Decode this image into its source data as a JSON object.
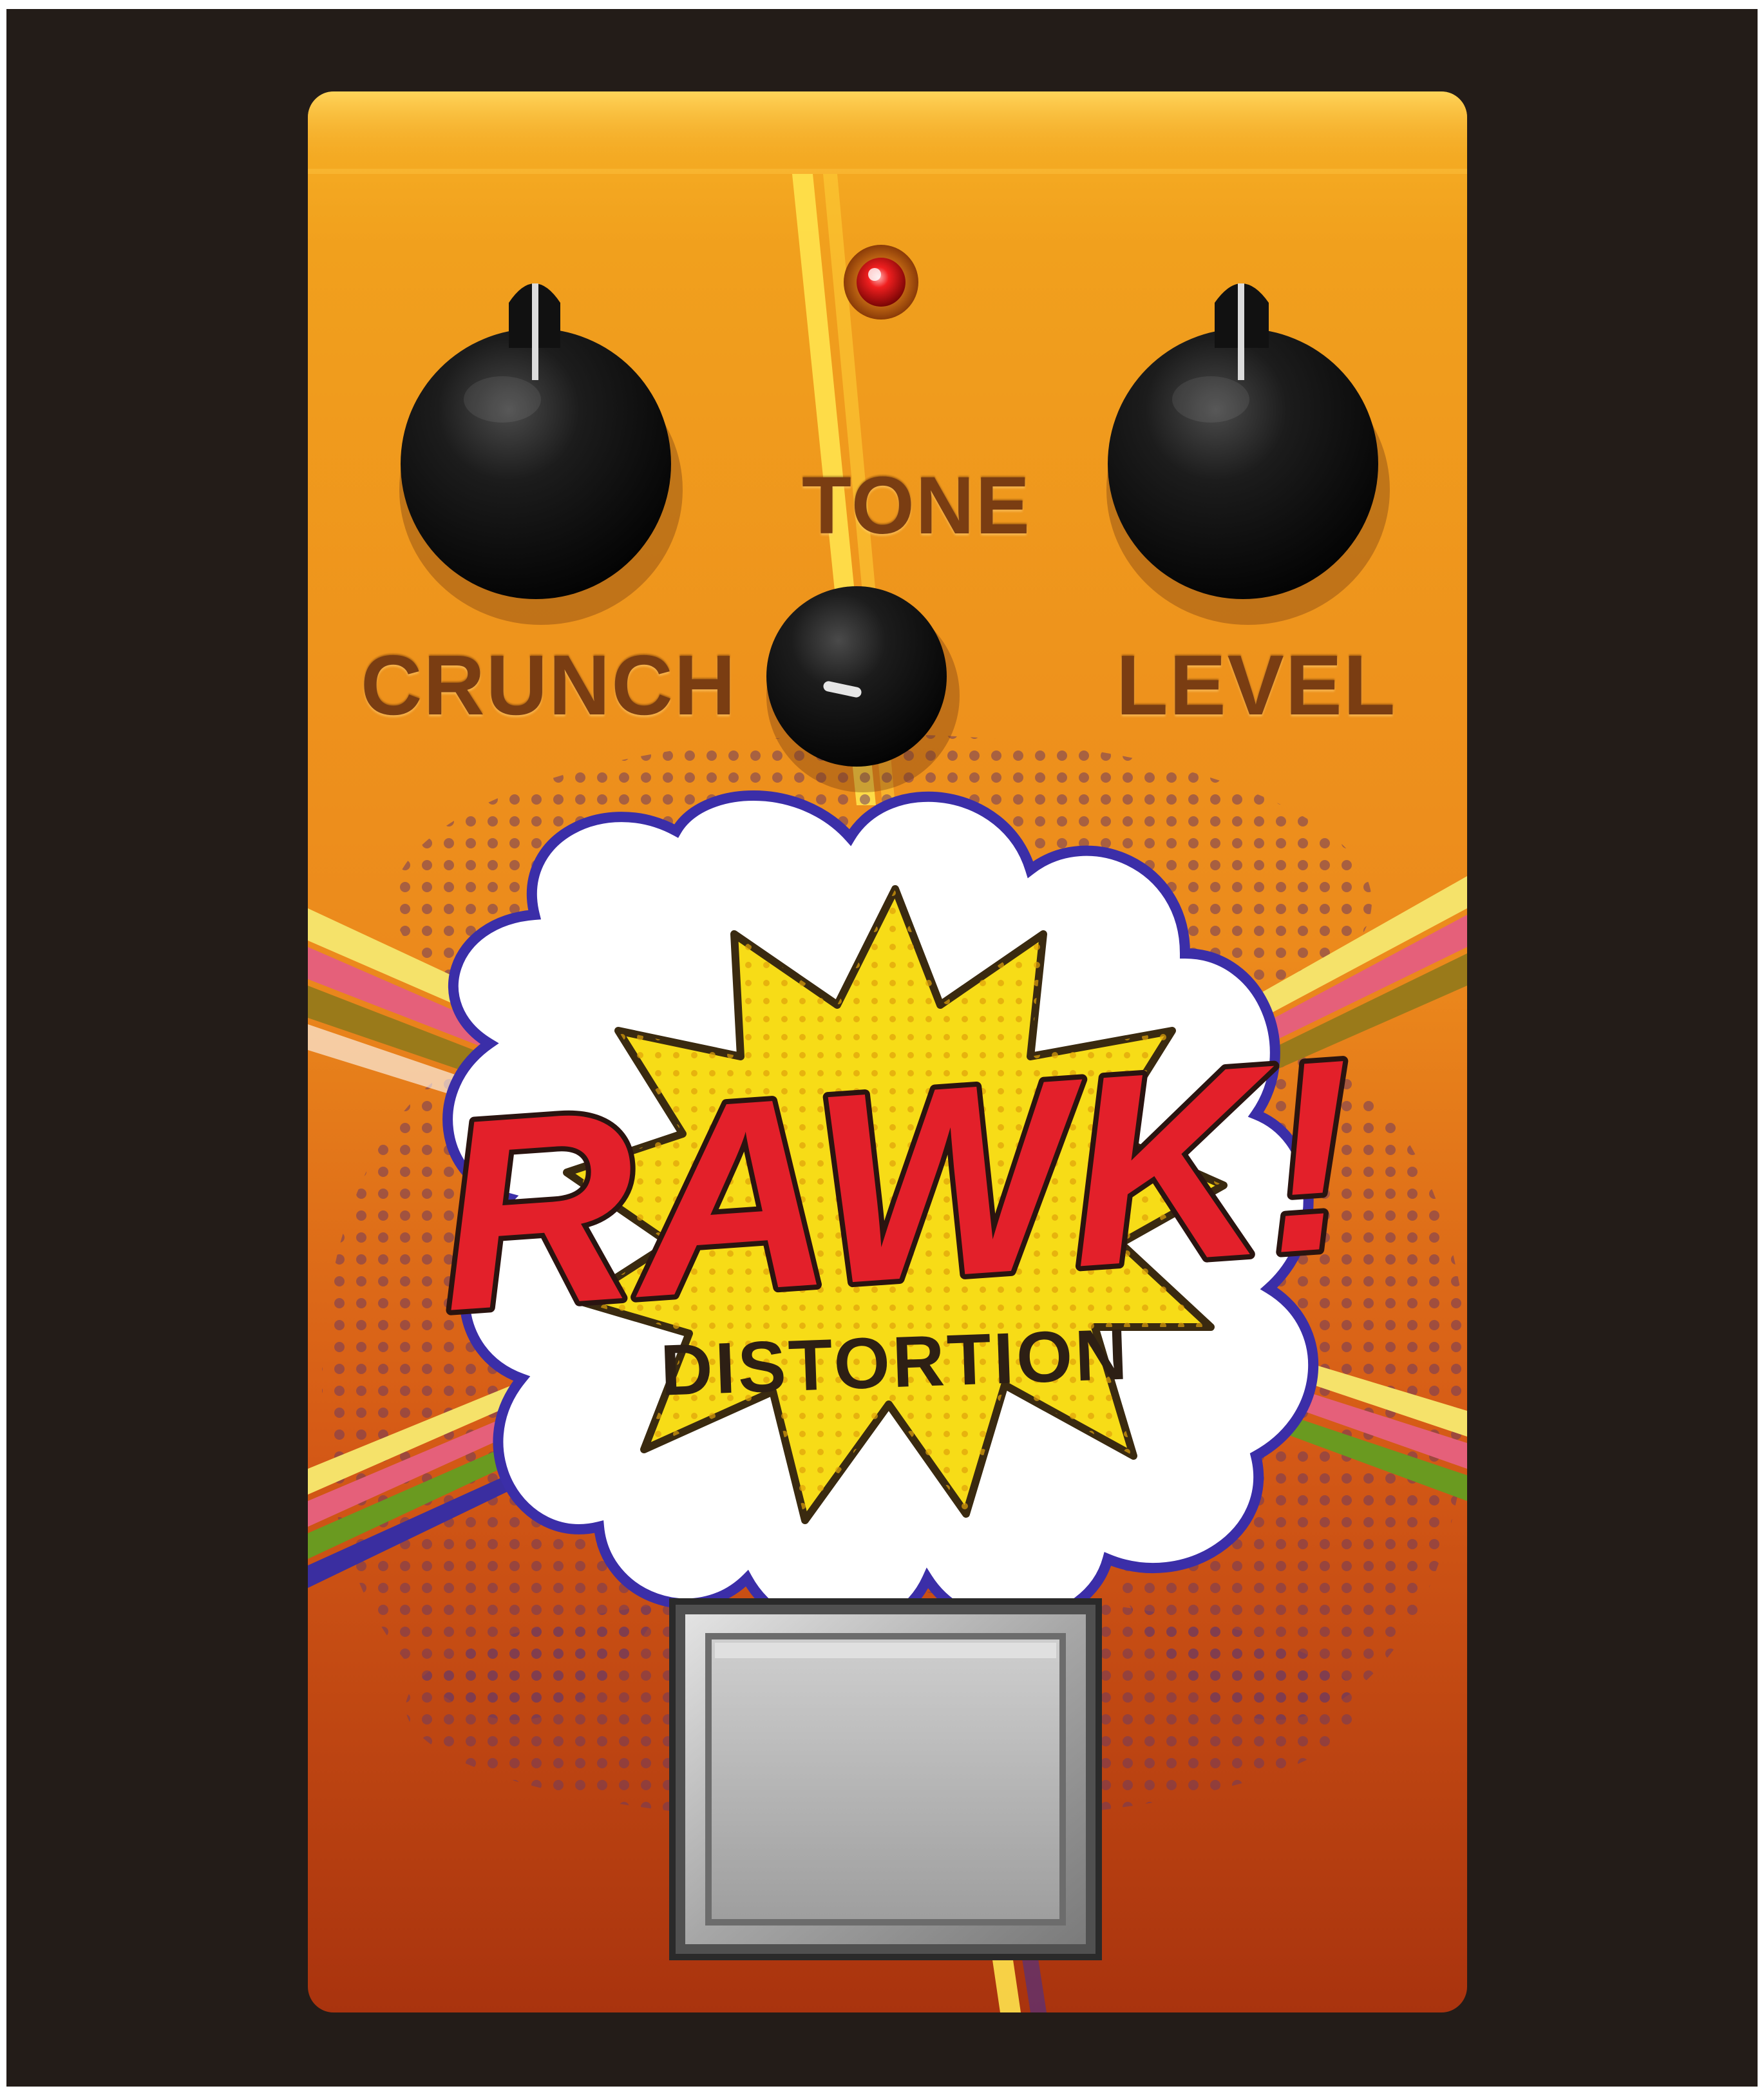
{
  "pedal": {
    "brand_logo": "RAWK!",
    "name": "DISTORTION",
    "controls": {
      "crunch_label": "CRUNCH",
      "tone_label": "TONE",
      "level_label": "LEVEL"
    },
    "led": {
      "state": "on",
      "color": "#e01616"
    },
    "footswitch": {
      "type": "square-metal-stomp"
    }
  },
  "colors": {
    "background": "#231c18",
    "body_top": "#f3a41e",
    "body_bottom": "#b1380f",
    "knob": "#0e0e0e",
    "label_text": "#7a3d12",
    "logo_red": "#e3202a",
    "burst_yellow": "#f7dc17",
    "cloud_white": "#ffffff",
    "outline_blue": "#3b2ea8"
  },
  "icons": [
    "crunch-knob-icon",
    "level-knob-icon",
    "tone-knob-icon",
    "led-icon",
    "footswitch-icon",
    "explosion-burst-icon"
  ]
}
